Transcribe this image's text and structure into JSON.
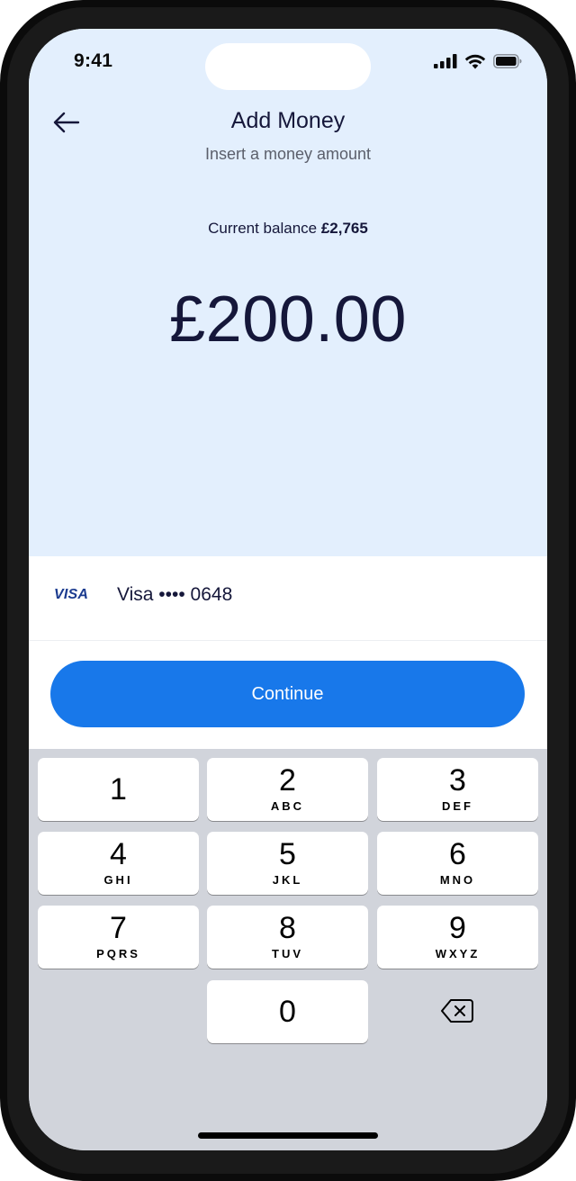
{
  "status_bar": {
    "time": "9:41"
  },
  "header": {
    "title": "Add Money",
    "subtitle": "Insert a money amount",
    "back_icon": "arrow-left-icon"
  },
  "balance": {
    "label": "Current balance",
    "value": "£2,765"
  },
  "amount": {
    "value": "£200.00"
  },
  "payment_method": {
    "brand_logo": "VISA",
    "label": "Visa •••• 0648"
  },
  "actions": {
    "continue_label": "Continue"
  },
  "keypad": {
    "keys": [
      {
        "digit": "1",
        "letters": ""
      },
      {
        "digit": "2",
        "letters": "ABC"
      },
      {
        "digit": "3",
        "letters": "DEF"
      },
      {
        "digit": "4",
        "letters": "GHI"
      },
      {
        "digit": "5",
        "letters": "JKL"
      },
      {
        "digit": "6",
        "letters": "MNO"
      },
      {
        "digit": "7",
        "letters": "PQRS"
      },
      {
        "digit": "8",
        "letters": "TUV"
      },
      {
        "digit": "9",
        "letters": "WXYZ"
      },
      {
        "digit": "0",
        "letters": ""
      }
    ],
    "delete_icon": "backspace-icon"
  },
  "colors": {
    "background_top": "#e3effd",
    "primary_button": "#1878ea",
    "text_dark": "#15173a",
    "keypad_bg": "#d1d4db"
  }
}
